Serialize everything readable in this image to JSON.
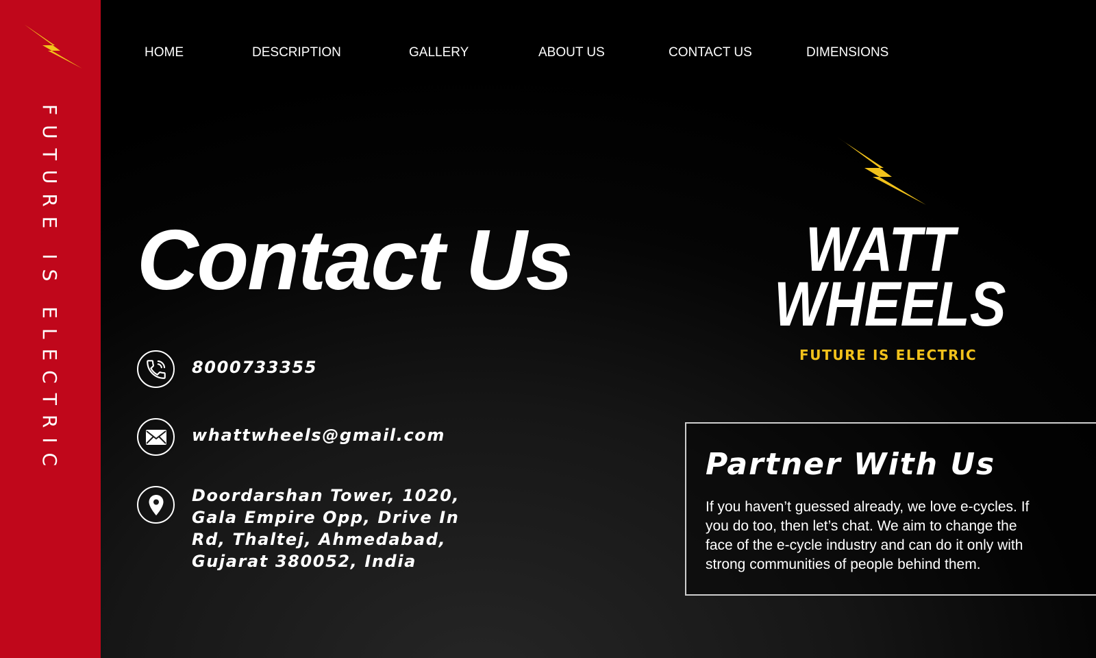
{
  "brand": {
    "name_line1": "WATT",
    "name_line2": "WHEELS",
    "tagline": "FUTURE IS ELECTRIC",
    "accent_red": "#c0071b",
    "accent_yellow": "#f2c21b"
  },
  "sidebar": {
    "tagline": "FUTURE IS ELECTRIC",
    "icon": "lightning-bolt-icon"
  },
  "nav": {
    "items": [
      {
        "label": "HOME"
      },
      {
        "label": "DESCRIPTION"
      },
      {
        "label": "GALLERY"
      },
      {
        "label": "ABOUT US"
      },
      {
        "label": "CONTACT US"
      },
      {
        "label": "DIMENSIONS"
      }
    ]
  },
  "main": {
    "title": "Contact Us",
    "contacts": {
      "phone": {
        "icon": "phone-icon",
        "value": "8000733355"
      },
      "email": {
        "icon": "mail-icon",
        "value": "whattwheels@gmail.com"
      },
      "address": {
        "icon": "location-pin-icon",
        "lines": [
          "Doordarshan Tower, 1020,",
          "Gala Empire Opp, Drive In",
          "Rd, Thaltej, Ahmedabad,",
          "Gujarat 380052, India"
        ]
      }
    }
  },
  "partner": {
    "heading": "Partner With Us",
    "body": "If you haven’t guessed already, we love e-cycles. If you do too, then let’s chat. We aim to change the face of the e-cycle industry and can do it only with strong communities of people behind them."
  }
}
